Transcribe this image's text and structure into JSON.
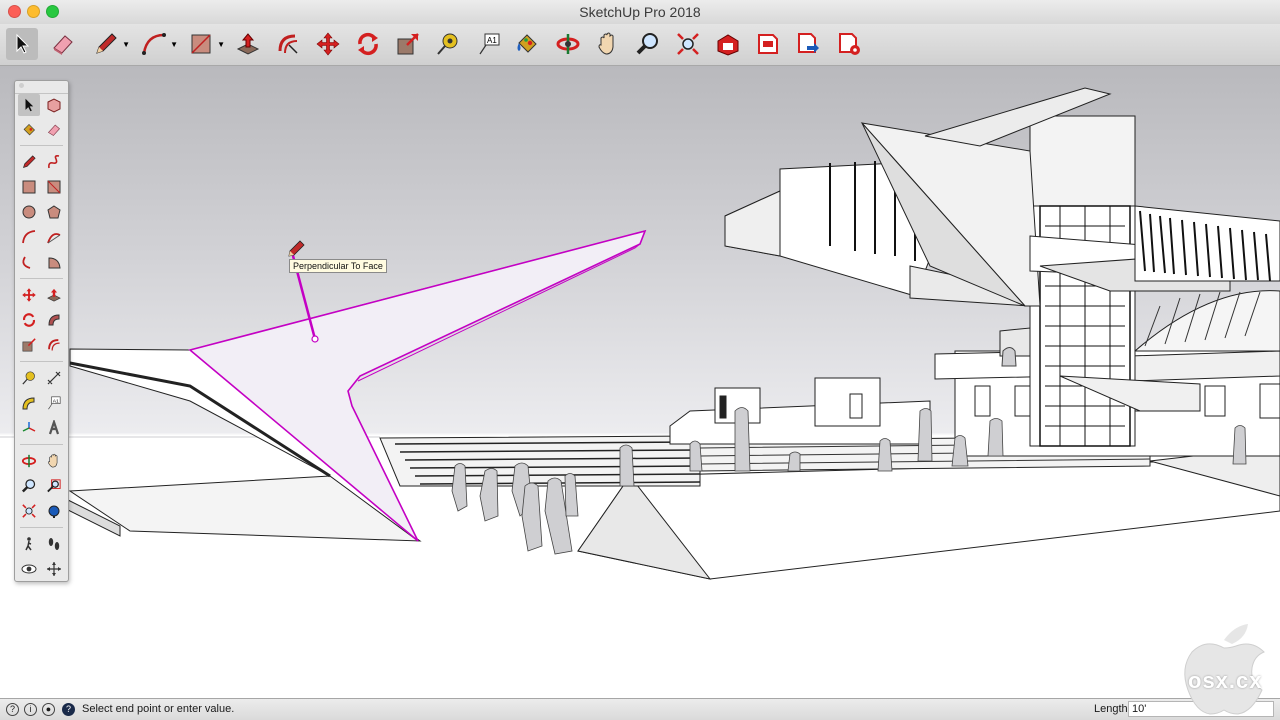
{
  "window": {
    "title": "SketchUp Pro 2018"
  },
  "toolbar": {
    "tools": [
      {
        "name": "Select",
        "icon": "select-arrow-icon",
        "active": true
      },
      {
        "name": "Eraser",
        "icon": "eraser-icon"
      },
      {
        "name": "Line",
        "icon": "pencil-icon"
      },
      {
        "name": "Arc",
        "icon": "arc-icon"
      },
      {
        "name": "Shapes",
        "icon": "rectangle-icon"
      },
      {
        "name": "Push/Pull",
        "icon": "push-pull-icon"
      },
      {
        "name": "Offset",
        "icon": "offset-icon"
      },
      {
        "name": "Move",
        "icon": "move-icon"
      },
      {
        "name": "Rotate",
        "icon": "rotate-icon"
      },
      {
        "name": "Scale",
        "icon": "scale-icon"
      },
      {
        "name": "Tape Measure",
        "icon": "tape-measure-icon"
      },
      {
        "name": "Text",
        "icon": "text-icon"
      },
      {
        "name": "Paint Bucket",
        "icon": "paint-bucket-icon"
      },
      {
        "name": "Orbit",
        "icon": "orbit-icon"
      },
      {
        "name": "Pan",
        "icon": "pan-hand-icon"
      },
      {
        "name": "Zoom",
        "icon": "zoom-icon"
      },
      {
        "name": "Zoom Extents",
        "icon": "zoom-extents-icon"
      },
      {
        "name": "3D Warehouse",
        "icon": "warehouse-icon"
      },
      {
        "name": "Extension Warehouse",
        "icon": "extension-warehouse-icon"
      },
      {
        "name": "Send to LayOut",
        "icon": "layout-send-icon"
      },
      {
        "name": "Extension Manager",
        "icon": "extension-manager-icon"
      }
    ]
  },
  "canvas": {
    "tooltip": "Perpendicular To Face",
    "inference_color": "#c400c4"
  },
  "statusbar": {
    "message": "Select end point or enter value.",
    "length_label": "Length",
    "length_value": "10'"
  },
  "watermark": {
    "text": "osx.cx"
  },
  "colors": {
    "accent_red": "#d42020",
    "inference_magenta": "#c400c4"
  }
}
